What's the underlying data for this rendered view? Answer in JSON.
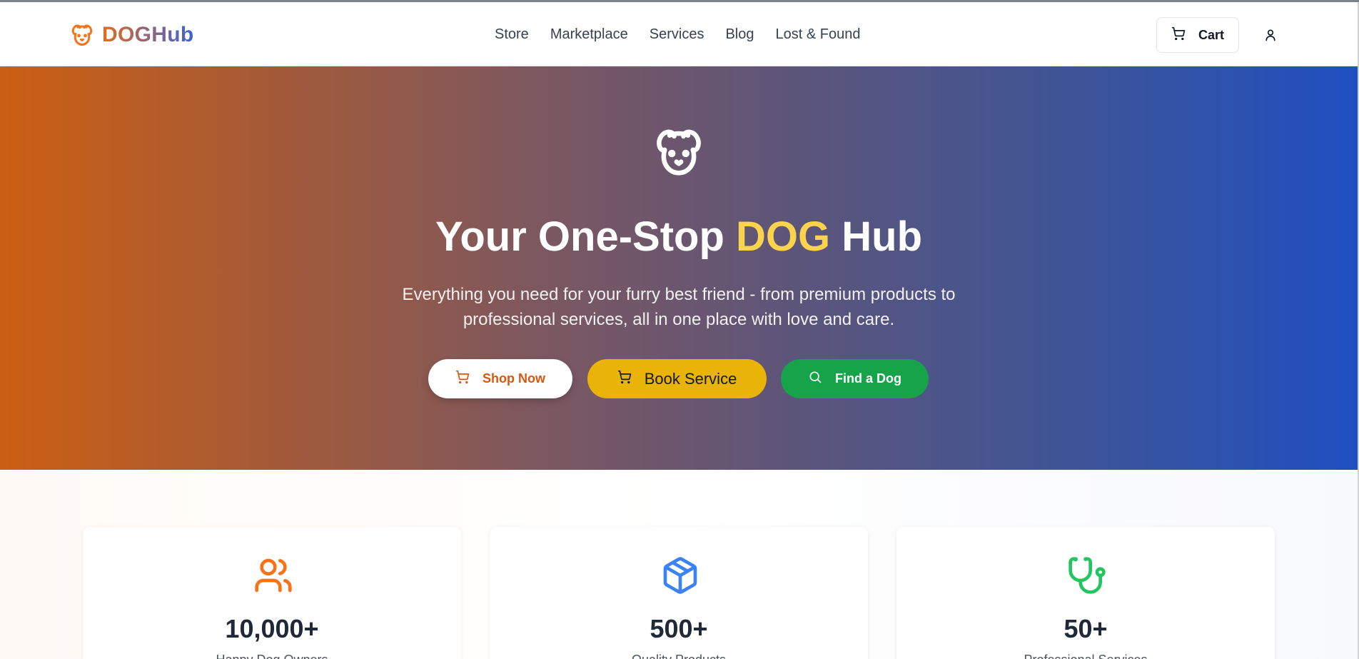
{
  "brand": {
    "name": "DOGHub"
  },
  "nav": {
    "items": [
      {
        "label": "Store"
      },
      {
        "label": "Marketplace"
      },
      {
        "label": "Services"
      },
      {
        "label": "Blog"
      },
      {
        "label": "Lost & Found"
      }
    ]
  },
  "header": {
    "cart_label": "Cart",
    "cart_icon": "cart-icon",
    "user_icon": "user-icon"
  },
  "hero": {
    "icon": "dog-icon",
    "title_prefix": "Your One-Stop ",
    "title_accent": "DOG",
    "title_suffix": " Hub",
    "subtitle": "Everything you need for your furry best friend - from premium products to professional services, all in one place with love and care.",
    "buttons": [
      {
        "label": "Shop Now",
        "icon": "cart-icon"
      },
      {
        "label": "Book Service",
        "icon": "cart-icon"
      },
      {
        "label": "Find a Dog",
        "icon": "search-icon"
      }
    ]
  },
  "stats": [
    {
      "value": "10,000+",
      "label": "Happy Dog Owners",
      "icon": "users-icon",
      "color": "#f97316"
    },
    {
      "value": "500+",
      "label": "Quality Products",
      "icon": "package-icon",
      "color": "#3b82f6"
    },
    {
      "value": "50+",
      "label": "Professional Services",
      "icon": "stethoscope-icon",
      "color": "#22c55e"
    }
  ],
  "colors": {
    "brand_orange": "#e66a1a",
    "brand_blue": "#3d62d6",
    "hero_start": "#cc5f13",
    "hero_end": "#1f4fc1",
    "accent_yellow": "#fcd34d",
    "book_button": "#eab308",
    "find_button": "#16a34a"
  }
}
